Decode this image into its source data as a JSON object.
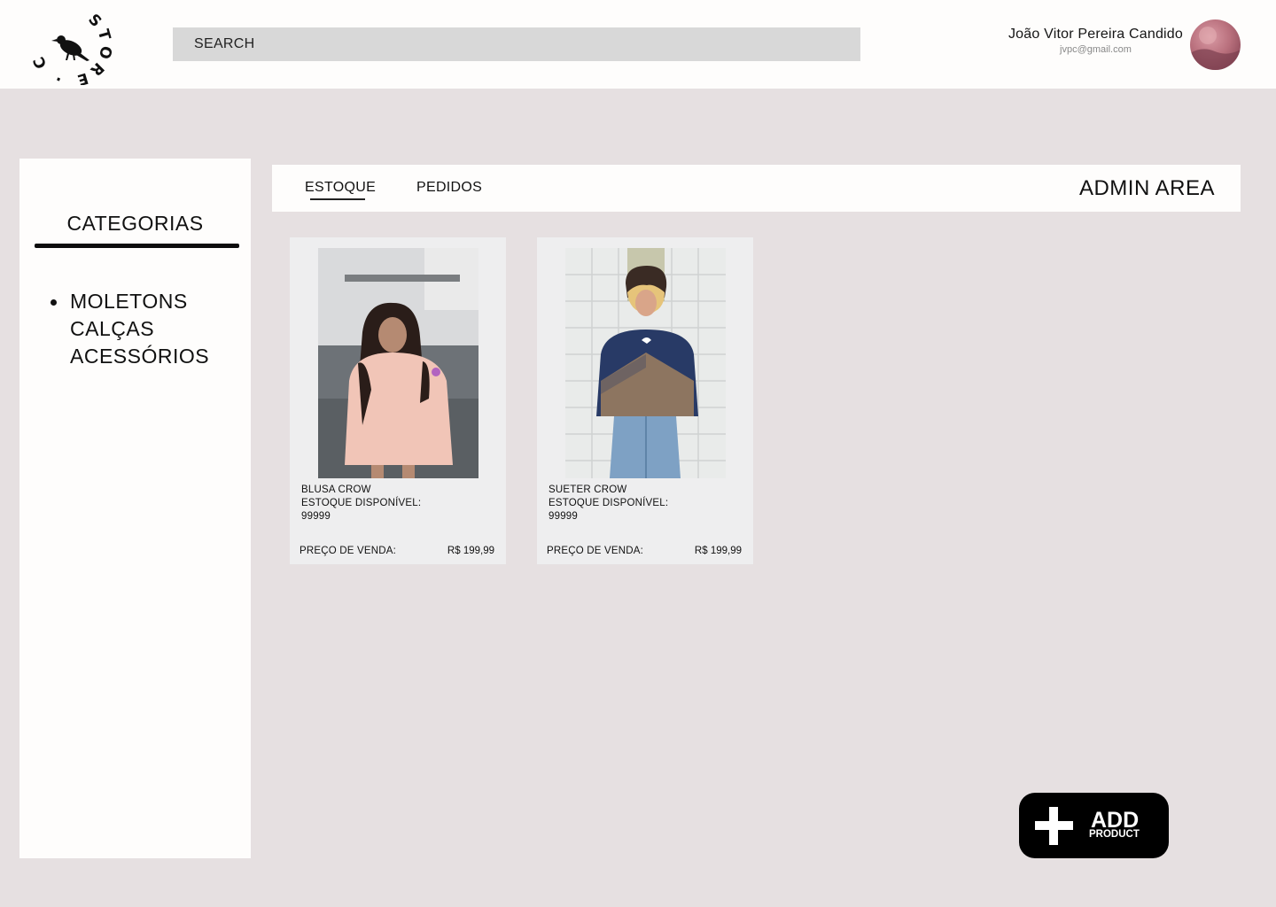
{
  "header": {
    "logo_text": "STORE · CROW ·",
    "search_placeholder": "SEARCH",
    "user_name": "João Vitor Pereira Candido",
    "user_email": "jvpc@gmail.com"
  },
  "sidebar": {
    "title": "CATEGORIAS",
    "items": [
      "MOLETONS",
      "CALÇAS",
      "ACESSÓRIOS"
    ]
  },
  "tabs": {
    "items": [
      "ESTOQUE",
      "PEDIDOS"
    ],
    "active": "ESTOQUE",
    "admin_title": "ADMIN AREA"
  },
  "products": [
    {
      "name": "BLUSA CROW",
      "stock_label": "ESTOQUE DISPONÍVEL:",
      "stock": "99999",
      "price_label": "PREÇO DE VENDA:",
      "price": "R$ 199,99"
    },
    {
      "name": "SUETER CROW",
      "stock_label": "ESTOQUE DISPONÍVEL:",
      "stock": "99999",
      "price_label": "PREÇO DE VENDA:",
      "price": "R$ 199,99"
    }
  ],
  "add_button": {
    "main": "ADD",
    "sub": "PRODUCT"
  },
  "colors": {
    "background": "#e6e0e1",
    "panel": "#fefdfc",
    "search": "#d8d8d8",
    "card": "#eeeeef",
    "button": "#000000"
  }
}
